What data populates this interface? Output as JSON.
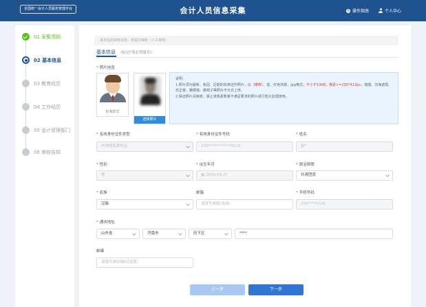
{
  "header": {
    "platform_name": "全国统一会计人员服务管理平台",
    "title": "会计人员信息采集",
    "guide_label": "操作指南",
    "user_label": "个人中心"
  },
  "sidebar": {
    "steps": [
      {
        "label": "01 采集须知",
        "state": "done"
      },
      {
        "label": "02 基本信息",
        "state": "active"
      },
      {
        "label": "03 教育经历",
        "state": "pending"
      },
      {
        "label": "04 工作经历",
        "state": "pending"
      },
      {
        "label": "05 会计管理部门",
        "state": "pending"
      },
      {
        "label": "06 审核告知",
        "state": "pending"
      }
    ]
  },
  "main": {
    "status_text": "基本信息审核状态：未提交审核（人工审核）",
    "tab_label": "基本信息",
    "tab_note": "(标记*项必须填写)",
    "photo": {
      "label": "照片信息",
      "standard_caption": "标准样式",
      "upload_caption": "选择照片"
    },
    "notice": {
      "title": "说明：",
      "line1_a": "1.照片须为最新、免冠、近期的标准证件照片，",
      "line1_red1": "白（推荐）",
      "line1_b": "、蓝、红色背景，jpg格式，",
      "line1_red2": "不小于10KB，像素",
      "line1_red3": ">=295*413px",
      "line1_c": "，端端、刘海遮眉、非正装、戴眼镜、戴帽子等照片不允许上传。",
      "line2": "2.保证照片清晰度，禁止将像素数量不满足要求的照片进行放大处理使用。"
    },
    "fields": {
      "id_type_label": "有效身份证件类型",
      "id_type_value": "内地居民身份证",
      "id_number_label": "有效身份证件号码",
      "id_number_value": "370************0016",
      "name_label": "姓名",
      "name_value": "张*",
      "gender_label": "性别",
      "gender_value": "男",
      "birth_label": "出生年月",
      "birth_value": "2000-04-27",
      "political_label": "政治面貌",
      "political_value": "共青团员",
      "ethnicity_label": "民族",
      "ethnicity_value": "汉族",
      "email_label": "邮箱",
      "email_placeholder": "请填写邮箱(选填)",
      "phone_label": "手机号码",
      "phone_value": "158****5126",
      "address_label": "通讯地址",
      "province_value": "山东省",
      "city_value": "济南市",
      "district_value": "历下区",
      "street_value": "****",
      "postcode_label": "邮编",
      "postcode_placeholder": "请填写邮政编码(选填)"
    },
    "buttons": {
      "prev_label": "上一步",
      "next_label": "下一步"
    }
  }
}
